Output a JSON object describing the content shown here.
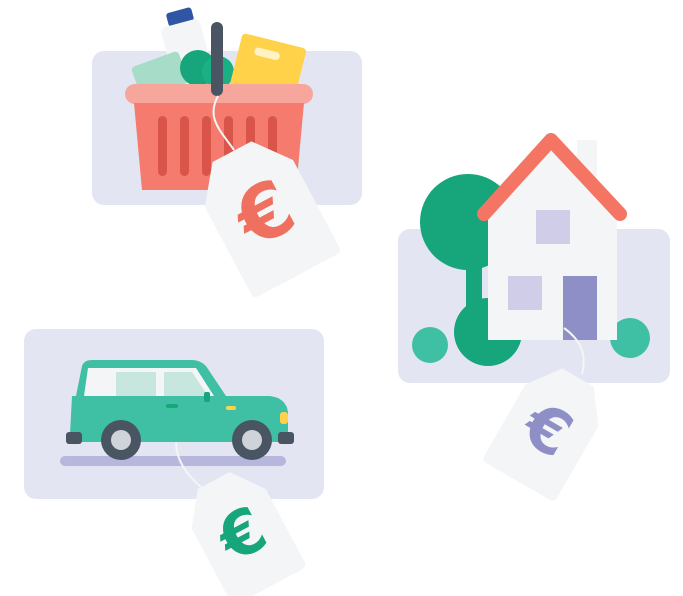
{
  "illustration": {
    "tags": [
      {
        "for": "shopping-basket",
        "symbol": "€",
        "color": "#F07060"
      },
      {
        "for": "house",
        "symbol": "€",
        "color": "#8E8FC6"
      },
      {
        "for": "car",
        "symbol": "€",
        "color": "#17A57B"
      }
    ],
    "colors": {
      "card": "#E3E6F2",
      "tag": "#F4F5F6",
      "basket": "#F47B6D",
      "roof": "#F47564",
      "tree": "#17A57B",
      "car_body": "#3FC0A4",
      "car_shadow": "#B7B7DD",
      "house_wall": "#F4F5F6",
      "house_window": "#CFCDE7"
    }
  }
}
